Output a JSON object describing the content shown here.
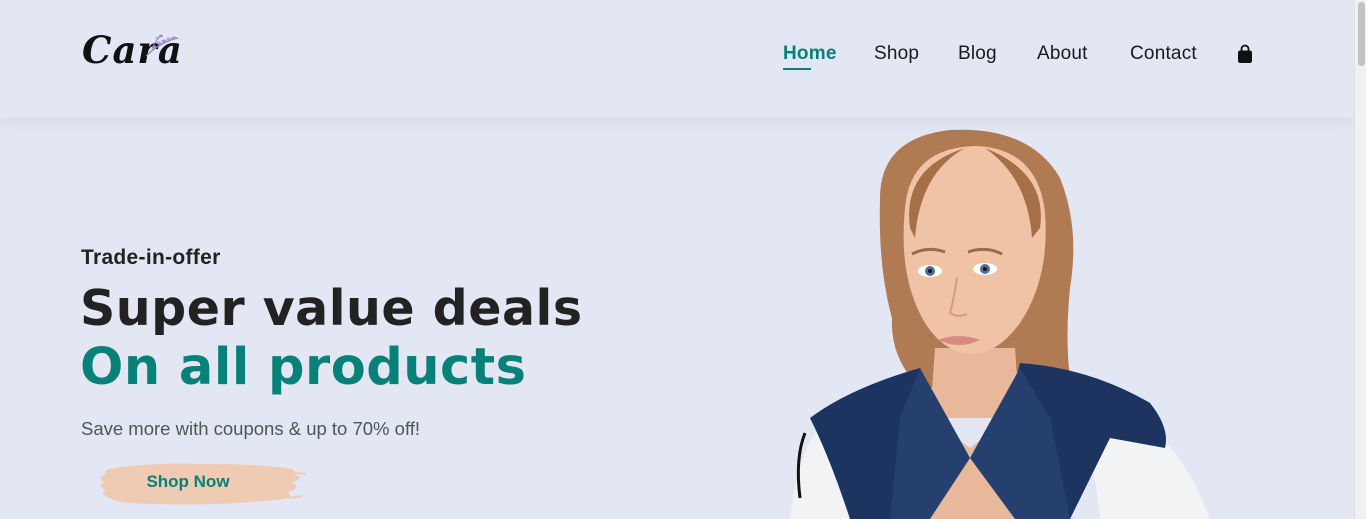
{
  "brand": {
    "logo_text": "Cara"
  },
  "nav": {
    "items": [
      {
        "label": "Home",
        "active": true
      },
      {
        "label": "Shop"
      },
      {
        "label": "Blog"
      },
      {
        "label": "About"
      },
      {
        "label": "Contact"
      }
    ],
    "cart_icon": "shopping-bag-icon"
  },
  "hero": {
    "eyebrow": "Trade-in-offer",
    "headline": "Super value deals",
    "headline_accent": "On all products",
    "subtext": "Save more with coupons & up to 70% off!",
    "cta_label": "Shop Now"
  },
  "colors": {
    "background": "#e3e6f3",
    "accent": "#088178",
    "button_bg": "#f0cbb3",
    "text_dark": "#222222"
  }
}
